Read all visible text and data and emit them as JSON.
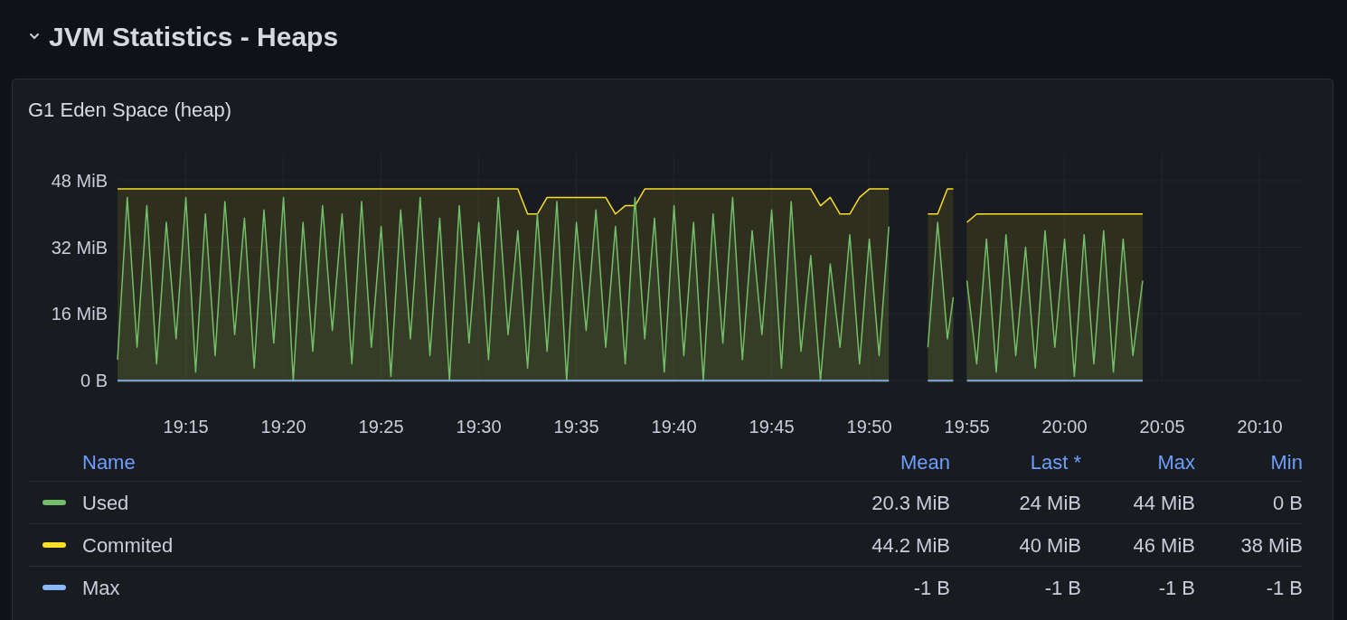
{
  "section": {
    "title": "JVM Statistics - Heaps",
    "expanded": true
  },
  "panel": {
    "title": "G1 Eden Space (heap)",
    "chart_data": {
      "type": "area",
      "grid": true,
      "xlim": [
        1151.5,
        1212.15
      ],
      "ylim": [
        0,
        54.5
      ],
      "xticks": [
        {
          "value": 1155,
          "label": "19:15"
        },
        {
          "value": 1160,
          "label": "19:20"
        },
        {
          "value": 1165,
          "label": "19:25"
        },
        {
          "value": 1170,
          "label": "19:30"
        },
        {
          "value": 1175,
          "label": "19:35"
        },
        {
          "value": 1180,
          "label": "19:40"
        },
        {
          "value": 1185,
          "label": "19:45"
        },
        {
          "value": 1190,
          "label": "19:50"
        },
        {
          "value": 1195,
          "label": "19:55"
        },
        {
          "value": 1200,
          "label": "20:00"
        },
        {
          "value": 1205,
          "label": "20:05"
        },
        {
          "value": 1210,
          "label": "20:10"
        }
      ],
      "yticks": [
        {
          "value": 0,
          "label": "0 B"
        },
        {
          "value": 16,
          "label": "16 MiB"
        },
        {
          "value": 32,
          "label": "32 MiB"
        },
        {
          "value": 48,
          "label": "48 MiB"
        }
      ],
      "x": [
        1151.5,
        1152,
        1152.5,
        1153,
        1153.5,
        1154,
        1154.5,
        1155,
        1155.5,
        1156,
        1156.5,
        1157,
        1157.5,
        1158,
        1158.5,
        1159,
        1159.5,
        1160,
        1160.5,
        1161,
        1161.5,
        1162,
        1162.5,
        1163,
        1163.5,
        1164,
        1164.5,
        1165,
        1165.5,
        1166,
        1166.5,
        1167,
        1167.5,
        1168,
        1168.5,
        1169,
        1169.5,
        1170,
        1170.5,
        1171,
        1171.5,
        1172,
        1172.5,
        1173,
        1173.5,
        1174,
        1174.5,
        1175,
        1175.5,
        1176,
        1176.5,
        1177,
        1177.5,
        1178,
        1178.5,
        1179,
        1179.5,
        1180,
        1180.5,
        1181,
        1181.5,
        1182,
        1182.5,
        1183,
        1183.5,
        1184,
        1184.5,
        1185,
        1185.5,
        1186,
        1186.5,
        1187,
        1187.5,
        1188,
        1188.5,
        1189,
        1189.5,
        1190,
        1190.5,
        1191,
        1193,
        1193.5,
        1194,
        1194.3,
        1195,
        1195.5,
        1196,
        1196.5,
        1197,
        1197.5,
        1198,
        1198.5,
        1199,
        1199.5,
        1200,
        1200.5,
        1201,
        1201.5,
        1202,
        1202.5,
        1203,
        1203.5,
        1204
      ],
      "series": [
        {
          "color": "#fade2a",
          "values": [
            46,
            46,
            46,
            46,
            46,
            46,
            46,
            46,
            46,
            46,
            46,
            46,
            46,
            46,
            46,
            46,
            46,
            46,
            46,
            46,
            46,
            46,
            46,
            46,
            46,
            46,
            46,
            46,
            46,
            46,
            46,
            46,
            46,
            46,
            46,
            46,
            46,
            46,
            46,
            46,
            46,
            46,
            40,
            40,
            44,
            44,
            44,
            44,
            44,
            44,
            44,
            40,
            42,
            42,
            46,
            46,
            46,
            46,
            46,
            46,
            46,
            46,
            46,
            46,
            46,
            46,
            46,
            46,
            46,
            46,
            46,
            46,
            42,
            44,
            40,
            40,
            44,
            46,
            46,
            46,
            40,
            40,
            46,
            46,
            38,
            40,
            40,
            40,
            40,
            40,
            40,
            40,
            40,
            40,
            40,
            40,
            40,
            40,
            40,
            40,
            40,
            40,
            40
          ]
        },
        {
          "color": "#73bf69",
          "values": [
            5,
            44,
            8,
            42,
            4,
            38,
            10,
            44,
            2,
            40,
            6,
            43,
            11,
            39,
            3,
            41,
            9,
            44,
            0,
            38,
            7,
            42,
            12,
            40,
            4,
            43,
            8,
            37,
            1,
            41,
            10,
            44,
            6,
            39,
            0,
            42,
            9,
            38,
            5,
            44,
            11,
            36,
            3,
            40,
            7,
            43,
            0,
            38,
            12,
            41,
            8,
            37,
            4,
            44,
            10,
            39,
            2,
            42,
            6,
            38,
            0,
            40,
            9,
            44,
            5,
            36,
            11,
            41,
            3,
            43,
            7,
            30,
            0,
            28,
            8,
            35,
            4,
            34,
            6,
            37,
            8,
            38,
            10,
            20,
            24,
            4,
            34,
            2,
            35,
            6,
            32,
            3,
            36,
            8,
            34,
            1,
            35,
            4,
            36,
            2,
            34,
            6,
            24
          ]
        },
        {
          "color": "#8ab8ff",
          "values": [
            0,
            0,
            0,
            0,
            0,
            0,
            0,
            0,
            0,
            0,
            0,
            0,
            0,
            0,
            0,
            0,
            0,
            0,
            0,
            0,
            0,
            0,
            0,
            0,
            0,
            0,
            0,
            0,
            0,
            0,
            0,
            0,
            0,
            0,
            0,
            0,
            0,
            0,
            0,
            0,
            0,
            0,
            0,
            0,
            0,
            0,
            0,
            0,
            0,
            0,
            0,
            0,
            0,
            0,
            0,
            0,
            0,
            0,
            0,
            0,
            0,
            0,
            0,
            0,
            0,
            0,
            0,
            0,
            0,
            0,
            0,
            0,
            0,
            0,
            0,
            0,
            0,
            0,
            0,
            0,
            0,
            0,
            0,
            0,
            0,
            0,
            0,
            0,
            0,
            0,
            0,
            0,
            0,
            0,
            0,
            0,
            0,
            0,
            0,
            0,
            0,
            0,
            0
          ]
        }
      ]
    },
    "legend": {
      "columns": [
        "Name",
        "Mean",
        "Last *",
        "Max",
        "Min"
      ],
      "rows": [
        {
          "name": "Used",
          "color": "#73bf69",
          "mean": "20.3 MiB",
          "last": "24 MiB",
          "max": "44 MiB",
          "min": "0 B"
        },
        {
          "name": "Commited",
          "color": "#fade2a",
          "mean": "44.2 MiB",
          "last": "40 MiB",
          "max": "46 MiB",
          "min": "38 MiB"
        },
        {
          "name": "Max",
          "color": "#8ab8ff",
          "mean": "-1 B",
          "last": "-1 B",
          "max": "-1 B",
          "min": "-1 B"
        }
      ]
    }
  }
}
